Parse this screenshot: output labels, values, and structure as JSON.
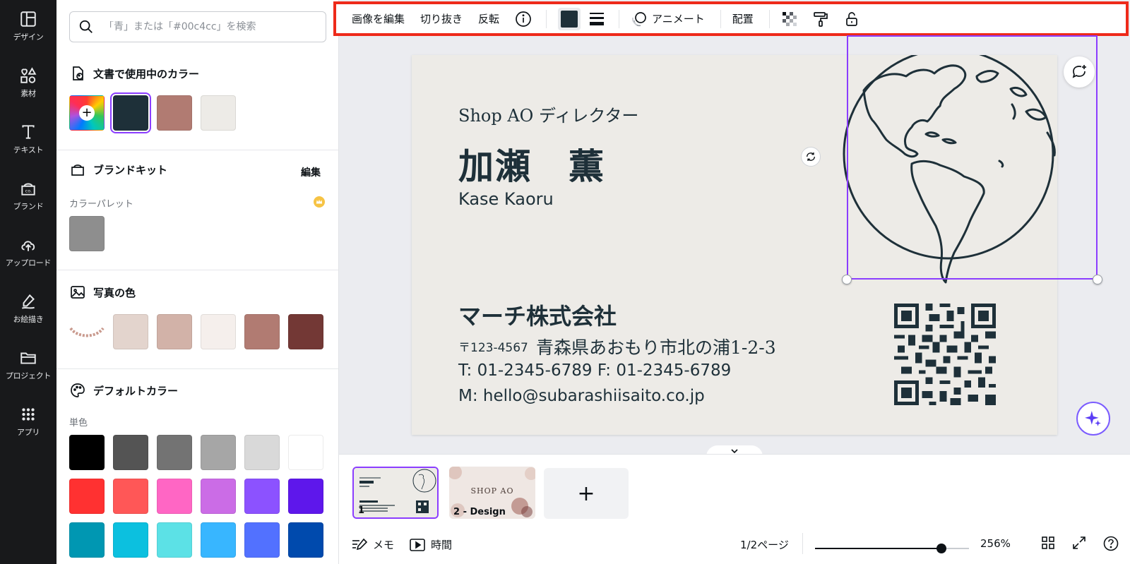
{
  "rail": {
    "items": [
      {
        "label": "デザイン"
      },
      {
        "label": "素材"
      },
      {
        "label": "テキスト"
      },
      {
        "label": "ブランド"
      },
      {
        "label": "アップロード"
      },
      {
        "label": "お絵描き"
      },
      {
        "label": "プロジェクト"
      },
      {
        "label": "アプリ"
      }
    ]
  },
  "panel": {
    "search_placeholder": "「青」または「#00c4cc」を検索",
    "doc_colors": {
      "title": "文書で使用中のカラー",
      "add_icon": "plus-icon",
      "swatches": [
        "#1e3039",
        "#b17b72",
        "#edebe7"
      ],
      "selected_index": 0
    },
    "brand_kit": {
      "title": "ブランドキット",
      "edit_label": "編集",
      "palette_label": "カラーパレット",
      "swatches": [
        "#8e8e8e"
      ]
    },
    "photo_colors": {
      "title": "写真の色",
      "swatches": [
        "#e3d4cd",
        "#d2b2a8",
        "#f5efec",
        "#b17b72",
        "#733835"
      ]
    },
    "default_colors": {
      "title": "デフォルトカラー",
      "sub_label": "単色",
      "rows": [
        [
          "#000000",
          "#545454",
          "#737373",
          "#a6a6a6",
          "#d9d9d9",
          "#ffffff"
        ],
        [
          "#ff3131",
          "#ff5757",
          "#ff66c4",
          "#cb6ce6",
          "#8c52ff",
          "#5e17eb"
        ],
        [
          "#0097b2",
          "#0cc0df",
          "#5ce1e6",
          "#38b6ff",
          "#5271ff",
          "#004aad"
        ]
      ]
    }
  },
  "toolbar": {
    "edit_image": "画像を編集",
    "crop": "切り抜き",
    "flip": "反転",
    "animate": "アニメート",
    "position": "配置",
    "color": "#1e3039"
  },
  "card": {
    "job_title": "Shop AO ディレクター",
    "name_jp": "加瀬　薫",
    "name_en": "Kase Kaoru",
    "company": "マーチ株式会社",
    "postal": "〒123-4567",
    "address": "青森県あおもり市北の浦1-2-3",
    "tel_fax": "T: 01-2345-6789   F: 01-2345-6789",
    "mail": "M: hello@subarashiisaito.co.jp"
  },
  "pages": {
    "items": [
      {
        "num": "1"
      },
      {
        "num": "2 - Design",
        "title": "SHOP AO"
      }
    ],
    "add_label": "+"
  },
  "bottombar": {
    "memo": "メモ",
    "timer": "時間",
    "page_count": "1/2ページ",
    "zoom": "256%",
    "zoom_fraction": 0.82
  }
}
